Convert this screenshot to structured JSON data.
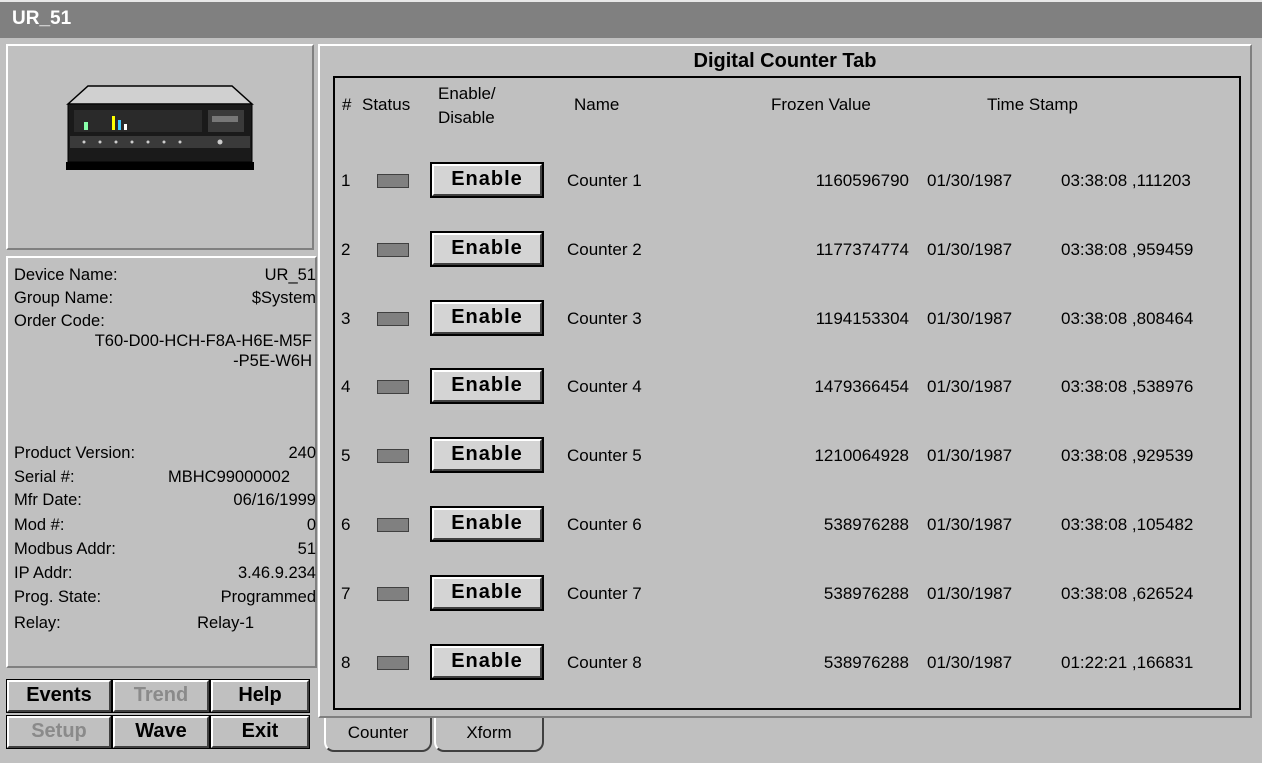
{
  "window": {
    "title": "UR_51"
  },
  "device_info": {
    "device_name_label": "Device Name:",
    "device_name": "UR_51",
    "group_name_label": "Group Name:",
    "group_name": "$System",
    "order_code_label": "Order Code:",
    "order_code_line1": "T60-D00-HCH-F8A-H6E-M5F",
    "order_code_line2": "-P5E-W6H",
    "product_version_label": "Product Version:",
    "product_version": "240",
    "serial_label": "Serial #:",
    "serial": "MBHC99000002",
    "mfr_date_label": "Mfr Date:",
    "mfr_date": "06/16/1999",
    "mod_label": "Mod #:",
    "mod": "0",
    "modbus_label": "Modbus Addr:",
    "modbus": "51",
    "ip_label": "IP Addr:",
    "ip": "3.46.9.234",
    "prog_state_label": "Prog. State:",
    "prog_state": "Programmed",
    "relay_label": "Relay:",
    "relay": "Relay-1"
  },
  "buttons": {
    "events": "Events",
    "trend": "Trend",
    "help": "Help",
    "setup": "Setup",
    "wave": "Wave",
    "exit": "Exit"
  },
  "main": {
    "title": "Digital Counter Tab",
    "headers": {
      "num": "#",
      "status": "Status",
      "enable_line1": "Enable/",
      "enable_line2": "Disable",
      "name": "Name",
      "frozen": "Frozen Value",
      "timestamp": "Time Stamp"
    },
    "rows": [
      {
        "num": "1",
        "button": "Enable",
        "name": "Counter 1",
        "frozen": "1160596790",
        "date": "01/30/1987",
        "time": "03:38:08 ,111203"
      },
      {
        "num": "2",
        "button": "Enable",
        "name": "Counter 2",
        "frozen": "1177374774",
        "date": "01/30/1987",
        "time": "03:38:08 ,959459"
      },
      {
        "num": "3",
        "button": "Enable",
        "name": "Counter 3",
        "frozen": "1194153304",
        "date": "01/30/1987",
        "time": "03:38:08 ,808464"
      },
      {
        "num": "4",
        "button": "Enable",
        "name": "Counter 4",
        "frozen": "1479366454",
        "date": "01/30/1987",
        "time": "03:38:08 ,538976"
      },
      {
        "num": "5",
        "button": "Enable",
        "name": "Counter 5",
        "frozen": "1210064928",
        "date": "01/30/1987",
        "time": "03:38:08 ,929539"
      },
      {
        "num": "6",
        "button": "Enable",
        "name": "Counter 6",
        "frozen": "538976288",
        "date": "01/30/1987",
        "time": "03:38:08 ,105482"
      },
      {
        "num": "7",
        "button": "Enable",
        "name": "Counter 7",
        "frozen": "538976288",
        "date": "01/30/1987",
        "time": "03:38:08 ,626524"
      },
      {
        "num": "8",
        "button": "Enable",
        "name": "Counter 8",
        "frozen": "538976288",
        "date": "01/30/1987",
        "time": "01:22:21 ,166831"
      }
    ]
  },
  "tabs": {
    "counter": "Counter",
    "xform": "Xform"
  },
  "colors": {
    "title_bar": "#808080",
    "panel": "#c0c0c0",
    "status_led": "#808080"
  }
}
